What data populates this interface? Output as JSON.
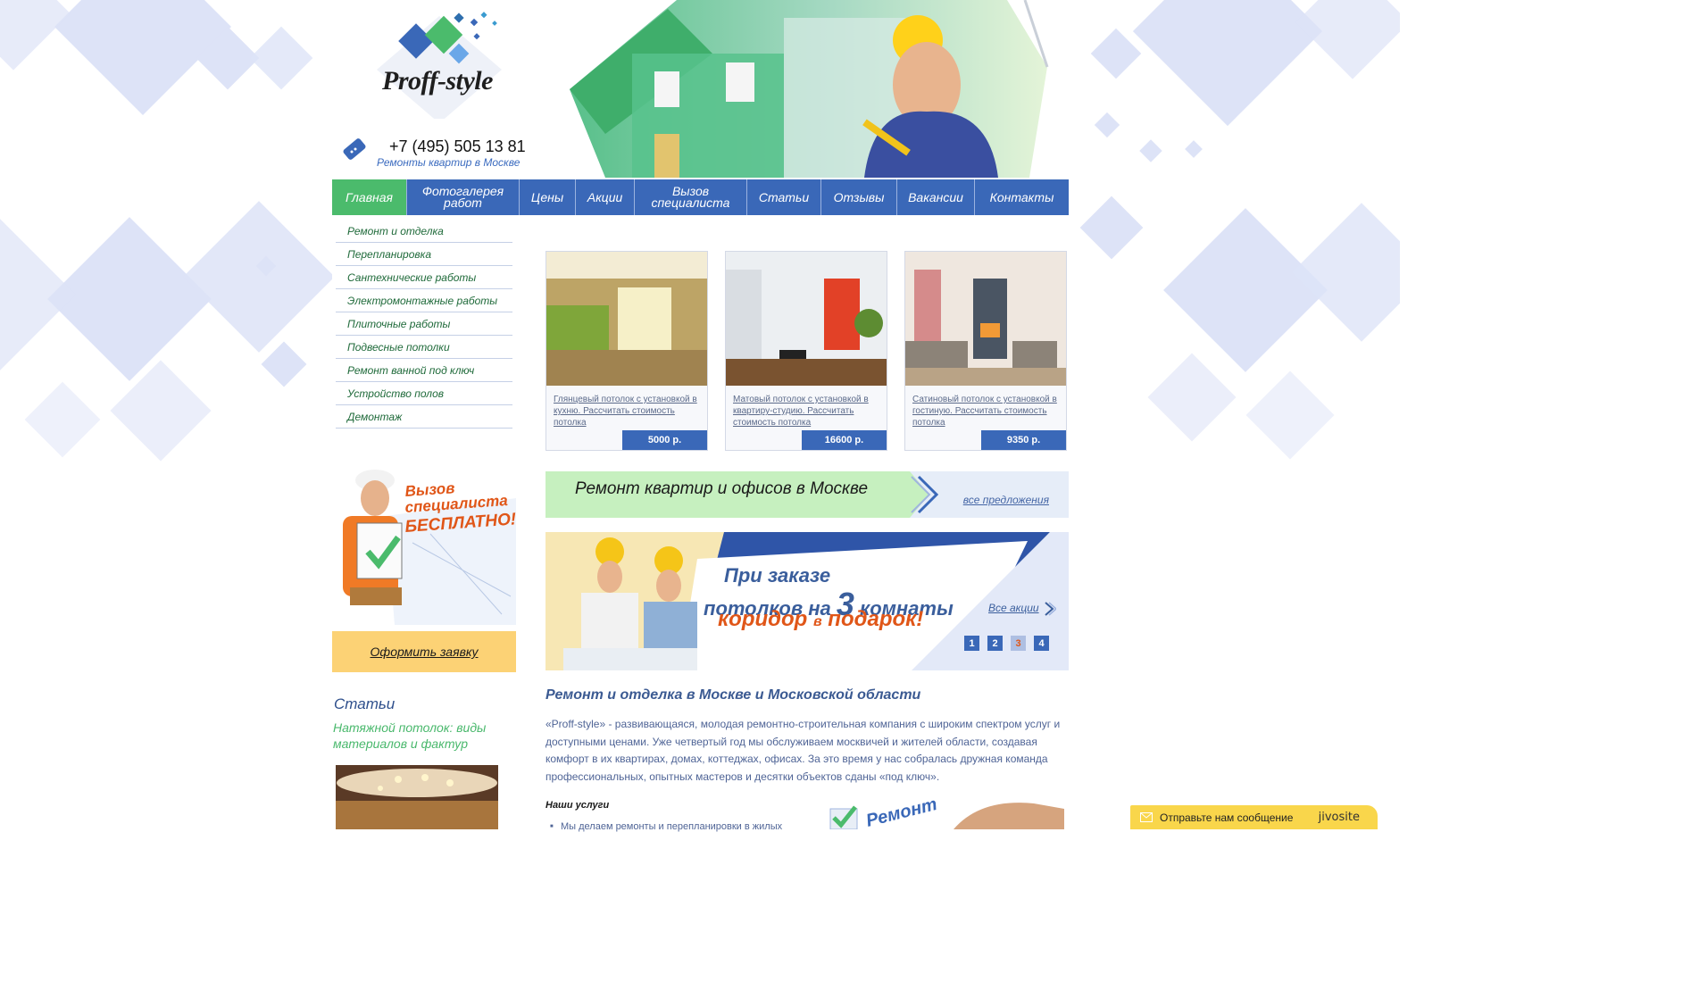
{
  "header": {
    "logo_text": "Proff-style",
    "phone": "+7 (495) 505 13 81",
    "tagline": "Ремонты квартир в Москве"
  },
  "nav": {
    "items": [
      {
        "label": "Главная",
        "active": true
      },
      {
        "label": "Фотогалерея работ"
      },
      {
        "label": "Цены"
      },
      {
        "label": "Акции"
      },
      {
        "label": "Вызов специалиста"
      },
      {
        "label": "Статьи"
      },
      {
        "label": "Отзывы"
      },
      {
        "label": "Вакансии"
      },
      {
        "label": "Контакты"
      }
    ]
  },
  "sidebar": {
    "items": [
      "Ремонт и отделка",
      "Перепланировка",
      "Сантехнические работы",
      "Электромонтажные работы",
      "Плиточные работы",
      "Подвесные потолки",
      "Ремонт ванной под ключ",
      "Устройство полов",
      "Демонтаж"
    ],
    "promo": {
      "line1": "Вызов",
      "line2": "специалиста",
      "line3": "БЕСПЛАТНО!"
    },
    "order_button": "Оформить заявку",
    "articles_title": "Статьи",
    "article_link": "Натяжной потолок: виды материалов и фактур"
  },
  "cards": [
    {
      "desc": "Глянцевый потолок с установкой в кухню. Рассчитать стоимость потолка",
      "price": "5000 р."
    },
    {
      "desc": "Матовый потолок с установкой в квартиру-студию. Рассчитать стоимость потолка",
      "price": "16600 р."
    },
    {
      "desc": "Сатиновый потолок с установкой в гостиную. Рассчитать стоимость потолка",
      "price": "9350 р."
    }
  ],
  "strip": {
    "title": "Ремонт квартир и офисов в Москве",
    "link": "все предложения"
  },
  "slider": {
    "line1": "При заказе",
    "line2_a": "потолков на ",
    "line2_num": "3",
    "line2_b": " комнаты",
    "line3_a": "коридор ",
    "line3_small": "в",
    "line3_b": " подарок!",
    "all_promos": "Все акции",
    "pages": [
      "1",
      "2",
      "3",
      "4"
    ],
    "active_page": "3"
  },
  "main": {
    "title": "Ремонт и отделка в Москве и Московской области",
    "paragraph": "«Proff-style» - развивающаяся, молодая ремонтно-строительная компания с широким спектром услуг и доступными ценами. Уже четвертый год мы обслуживаем москвичей и жителей области, создавая комфорт в их квартирах, домах, коттеджах, офисах. За это время у нас собралась дружная команда профессиональных, опытных мастеров и десятки объектов сданы «под ключ».",
    "services_title": "Наши услуги",
    "service_item": "Мы делаем ремонты и перепланировки в жилых",
    "repair_label": "Ремонт"
  },
  "chat": {
    "label": "Отправьте нам сообщение",
    "brand": "jivosite"
  },
  "colors": {
    "nav": "#3a68b8",
    "nav_active": "#4bbb6c",
    "accent_orange": "#e05618",
    "order_button": "#fcd275",
    "strip": "#c6f0bf",
    "chat": "#f9d64b"
  }
}
